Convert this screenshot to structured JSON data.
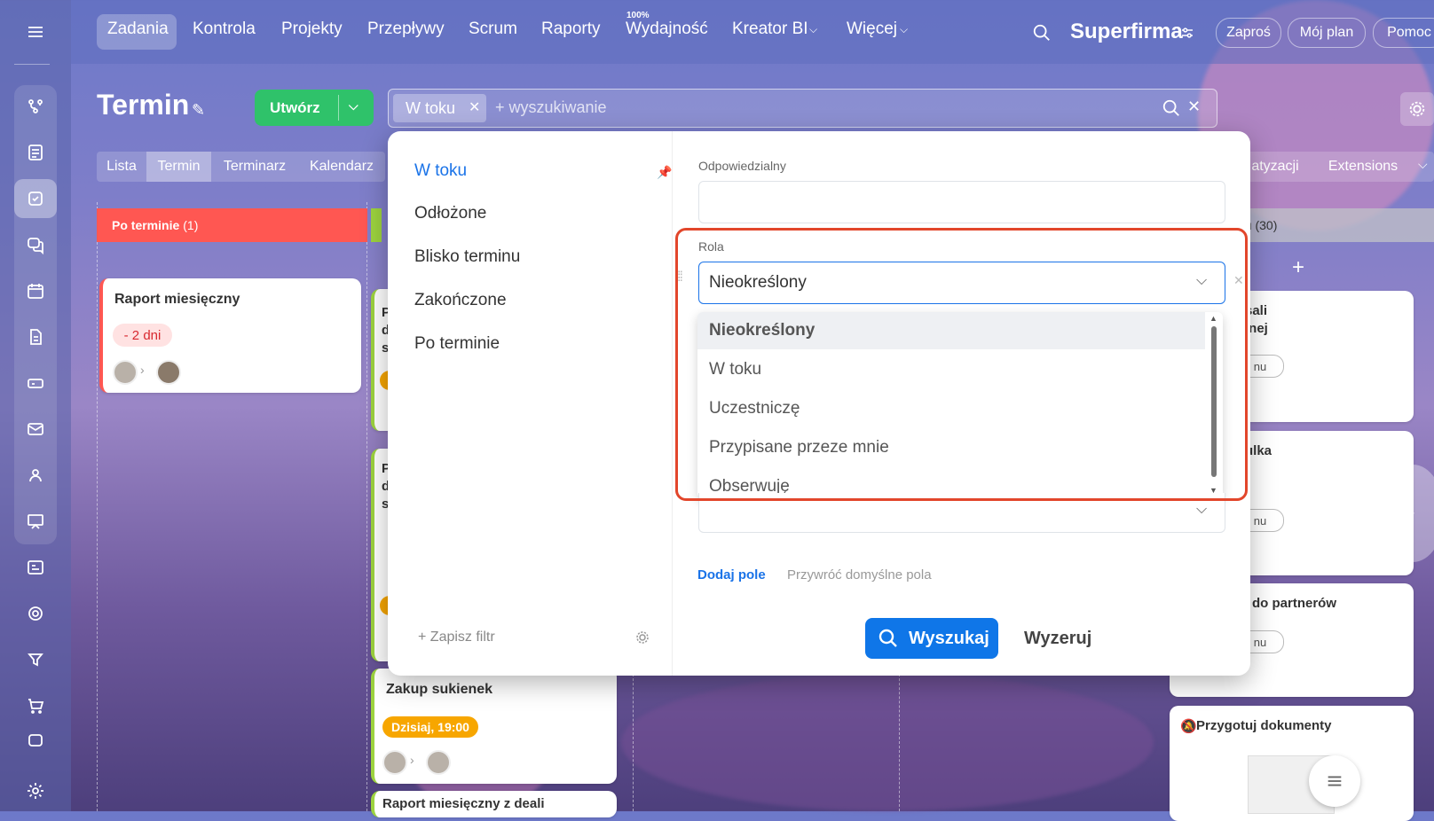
{
  "topnav": {
    "items": [
      "Zadania",
      "Kontrola",
      "Projekty",
      "Przepływy",
      "Scrum",
      "Raporty",
      "Wydajność",
      "Kreator BI",
      "Więcej"
    ],
    "efficiency_badge": "100%",
    "company": "Superfirma",
    "buttons": [
      "Zaproś",
      "Mój plan",
      "Pomoc"
    ]
  },
  "header": {
    "title": "Termin",
    "create_label": "Utwórz",
    "search_chip": "W toku",
    "search_placeholder": "+ wyszukiwanie"
  },
  "view_tabs": [
    "Lista",
    "Termin",
    "Terminarz",
    "Kalendarz"
  ],
  "right_tabs": [
    "atyzacji",
    "Extensions"
  ],
  "kanban": {
    "overdue_column": {
      "label": "Po terminie",
      "count": "(1)"
    },
    "right_column_count": "nu (30)",
    "cards": [
      {
        "title": "Raport miesięczny",
        "badge": "- 2 dni"
      },
      {
        "title": "Zakup sukienek",
        "badge": "Dzisiaj, 19:00"
      },
      {
        "title": "Raport miesięczny z deali"
      },
      {
        "title": "Przygotuj dokumenty"
      }
    ],
    "right_fragments": [
      "sali",
      "inej",
      "ulka",
      "do partnerów",
      "nu",
      "nu",
      "nu"
    ],
    "mid_fragments": [
      "P",
      "d",
      "s",
      "P",
      "d",
      "s"
    ]
  },
  "filter": {
    "presets": [
      "W toku",
      "Odłożone",
      "Blisko terminu",
      "Zakończone",
      "Po terminie"
    ],
    "save_filter": "+ Zapisz filtr",
    "responsible_label": "Odpowiedzialny",
    "role_label": "Rola",
    "role_value": "Nieokreślony",
    "role_options": [
      "Nieokreślony",
      "W toku",
      "Uczestniczę",
      "Przypisane przeze mnie",
      "Obserwuję"
    ],
    "add_field": "Dodaj pole",
    "restore_fields": "Przywróć domyślne pola",
    "search_button": "Wyszukaj",
    "reset_button": "Wyzeruj"
  },
  "colors": {
    "accent": "#0f76e8",
    "create": "#2fc26a",
    "overdue": "#ff5752",
    "highlight": "#e2462b"
  }
}
